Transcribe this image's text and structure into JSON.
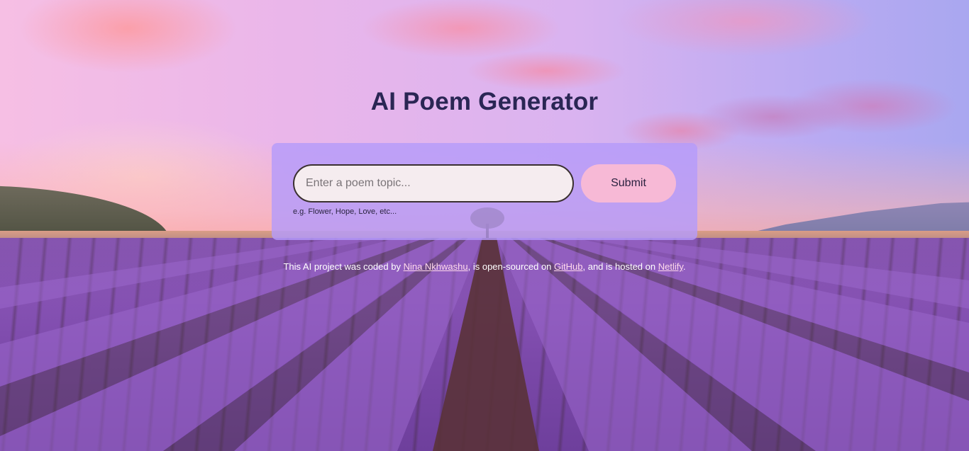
{
  "page": {
    "title": "AI Poem Generator"
  },
  "form": {
    "input_placeholder": "Enter a poem topic...",
    "input_value": "",
    "submit_label": "Submit",
    "hint": "e.g. Flower, Hope, Love, etc..."
  },
  "footer": {
    "text_1": "This AI project was coded by ",
    "author_link": "Nina Nkhwashu",
    "text_2": ", is open-sourced on ",
    "github_link": "GitHub",
    "text_3": ", and is hosted on ",
    "netlify_link": "Netlify",
    "text_4": "."
  },
  "colors": {
    "title": "#2a2654",
    "card": "#b49bfa",
    "input_bg": "#f5ecef",
    "button_bg": "#f7b9d6",
    "link": "#ffd9ec"
  },
  "background": {
    "scene": "lavender-field-at-sunset"
  }
}
